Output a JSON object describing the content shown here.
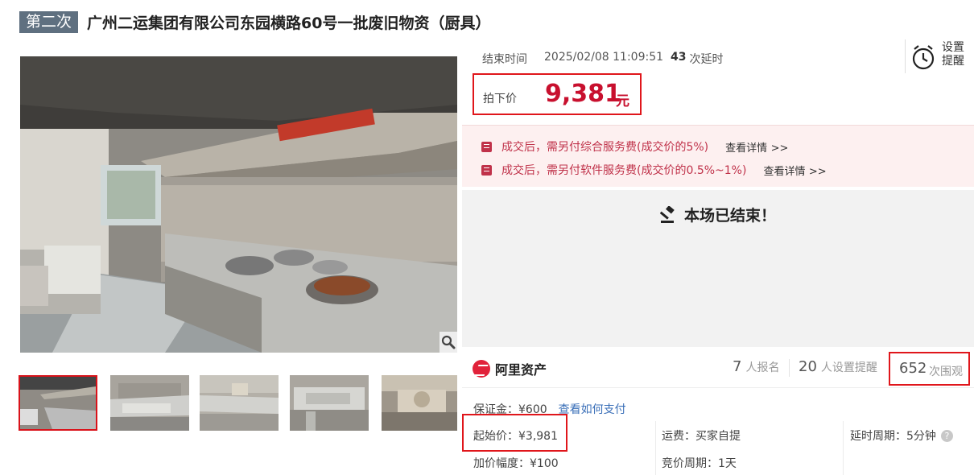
{
  "header": {
    "round_badge": "第二次",
    "title": "广州二运集团有限公司东园横路60号一批废旧物资（厨具）"
  },
  "gallery": {
    "main_image_desc": "kitchen-photo",
    "thumbnail_count": 5,
    "active_thumbnail": 1,
    "zoom_icon": "magnifier-icon"
  },
  "auction": {
    "end_label": "结束时间",
    "end_time": "2025/02/08 11:09:51",
    "extension_count": "43",
    "extension_label": "次延时",
    "reminder_label_line1": "设置",
    "reminder_label_line2": "提醒",
    "price_label": "拍下价",
    "price_value": "9,381",
    "price_unit": "元"
  },
  "fees": [
    {
      "text": "成交后，需另付综合服务费(成交价的5%)",
      "link": "查看详情",
      "arrow": ">>"
    },
    {
      "text": "成交后，需另付软件服务费(成交价的0.5%~1%)",
      "link": "查看详情",
      "arrow": ">>"
    }
  ],
  "status": {
    "ended_text": "本场已结束！"
  },
  "platform": {
    "logo_text": "阿里资产"
  },
  "stats": {
    "signups": "7",
    "signups_label": "人报名",
    "reminders": "20",
    "reminders_label": "人设置提醒",
    "views": "652",
    "views_label": "次围观"
  },
  "details": {
    "deposit": "保证金：¥600",
    "how_to_pay": "查看如何支付",
    "start_price": "起始价：¥3,981",
    "shipping": "运费：买家自提",
    "extend_period": "延时周期：5分钟",
    "increment": "加价幅度：¥100",
    "bid_period": "竞价周期：1天"
  },
  "colors": {
    "accent_red": "#c8102e",
    "highlight_border": "#e0161b",
    "badge_bg": "#5f7080",
    "link_blue": "#3a6fb8"
  }
}
